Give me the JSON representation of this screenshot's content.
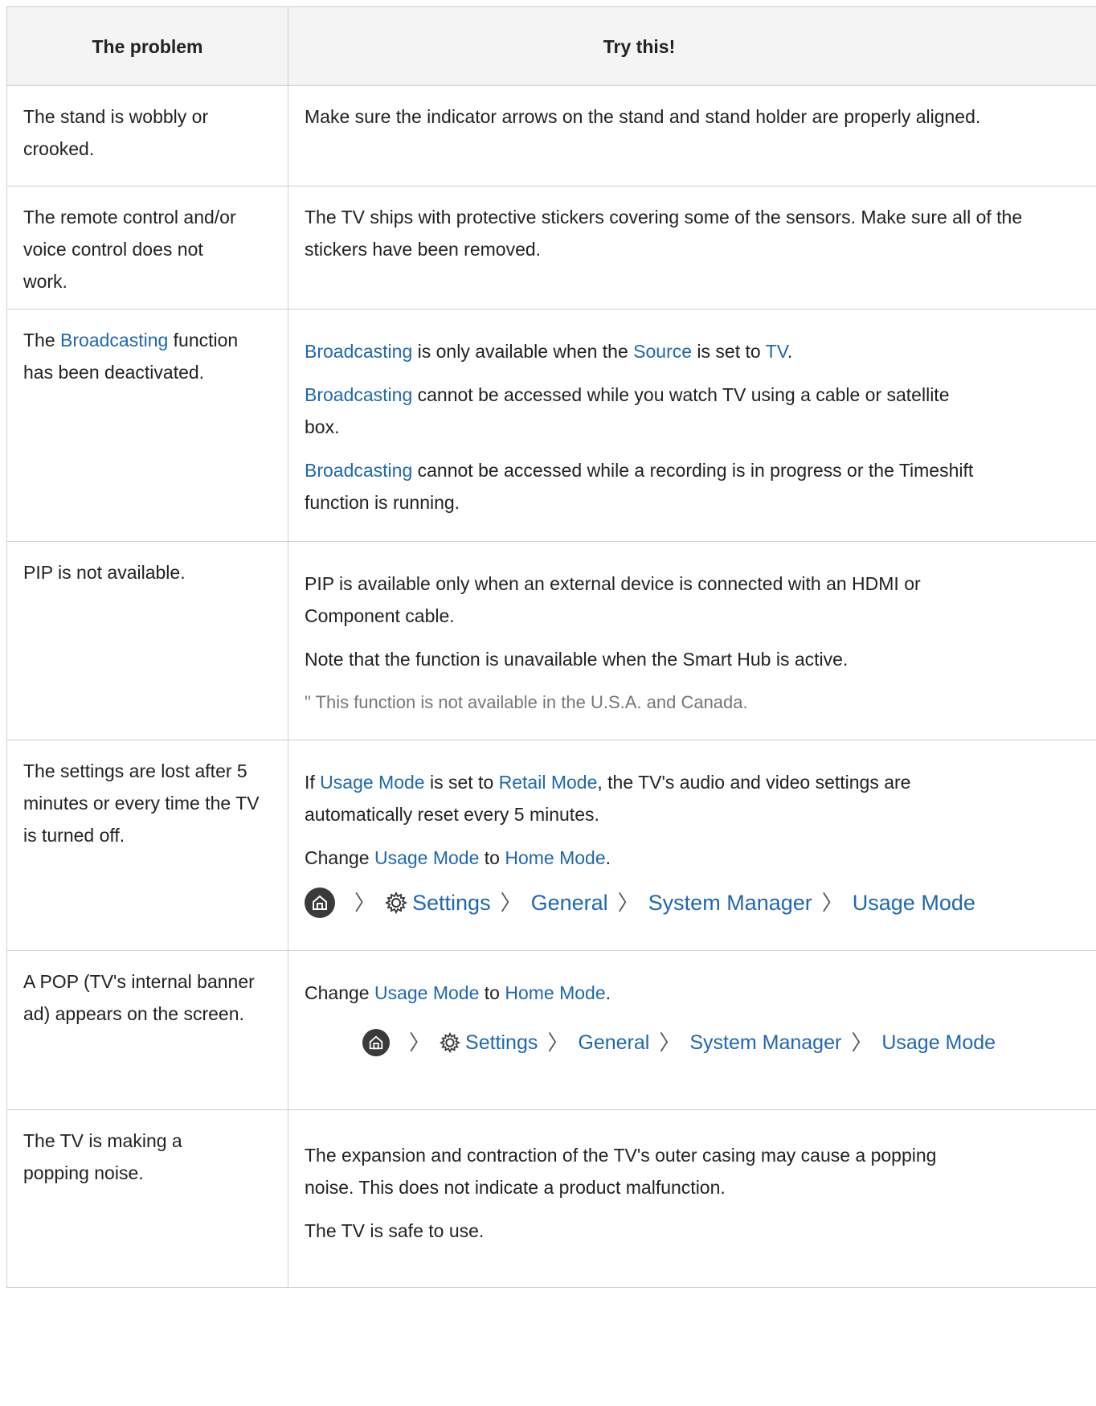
{
  "header": {
    "problem": "The problem",
    "try": "Try this!"
  },
  "rows": [
    {
      "problem": "The stand is wobbly or crooked.",
      "p1": "Make sure the indicator arrows on the stand and stand holder are properly aligned."
    },
    {
      "problem": "The remote control and/or voice control does not work.",
      "p1": "The TV ships with protective stickers covering some of the sensors. Make sure all of the stickers have been removed."
    },
    {
      "problem_pre": "The ",
      "problem_link": "Broadcasting",
      "problem_post": " function has been deactivated.",
      "p1_link1": "Broadcasting",
      "p1_mid1": " is only available when the ",
      "p1_link2": "Source",
      "p1_mid2": " is set to ",
      "p1_link3": "TV",
      "p1_end": ".",
      "p2_link": "Broadcasting",
      "p2_line1": " cannot be accessed while you watch TV using a cable or satellite",
      "p2_line2": "box.",
      "p3_link": "Broadcasting",
      "p3_line1": " cannot be accessed while a recording is in progress or the Timeshift",
      "p3_line2": "function is running."
    },
    {
      "problem": "PIP is not available.",
      "p1_line1": "PIP is available only when an external device is connected with an HDMI or",
      "p1_line2": "Component cable.",
      "p2": "Note that the function is unavailable when the Smart Hub is active.",
      "note": "\" This function is not available in the U.S.A. and Canada."
    },
    {
      "problem": "The settings are lost after 5 minutes or every time the TV is turned off.",
      "p1_pre": "If ",
      "p1_link1": "Usage Mode",
      "p1_mid": " is set to ",
      "p1_link2": "Retail Mode",
      "p1_line1_end": ", the TV's audio and video settings are",
      "p1_line2": "automatically reset every 5 minutes.",
      "p2_pre": "Change ",
      "p2_link1": "Usage Mode",
      "p2_mid": " to ",
      "p2_link2": "Home Mode",
      "p2_end": ".",
      "path": [
        "Settings",
        "General",
        "System Manager",
        "Usage Mode"
      ]
    },
    {
      "problem": "A POP (TV's internal banner ad) appears on the screen.",
      "p1_pre": "Change ",
      "p1_link1": "Usage Mode",
      "p1_mid": " to ",
      "p1_link2": "Home Mode",
      "p1_end": ".",
      "path": [
        "Settings",
        "General",
        "System Manager",
        "Usage Mode"
      ]
    },
    {
      "problem": "The TV is making a popping noise.",
      "p1_line1": "The expansion and contraction of the TV's outer casing may cause a popping",
      "p1_line2": "noise. This does not indicate a product malfunction.",
      "p2": "The TV is safe to use."
    }
  ]
}
